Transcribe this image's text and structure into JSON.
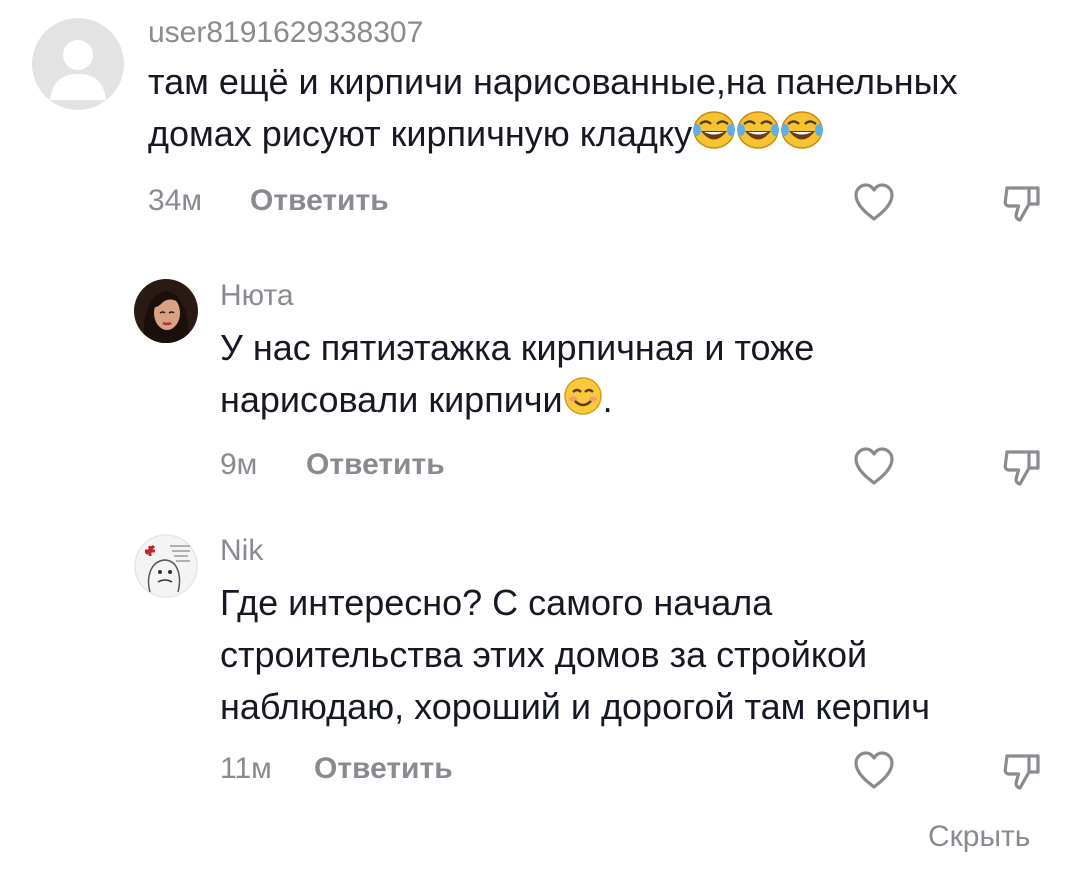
{
  "comments": [
    {
      "username": "user8191629338307",
      "lines": [
        "там ещё и кирпичи нарисованные,на панельных",
        "домах рисуют кирпичную кладку"
      ],
      "emoji": [
        "face-with-tears-of-joy",
        "face-with-tears-of-joy",
        "face-with-tears-of-joy"
      ],
      "time": "34м",
      "reply_label": "Ответить"
    },
    {
      "username": "Нюта",
      "lines": [
        "У нас пятиэтажка кирпичная и тоже",
        "нарисовали кирпичи"
      ],
      "emoji": [
        "smiling-face-with-smiling-eyes"
      ],
      "line2_suffix": ".",
      "time": "9м",
      "reply_label": "Ответить"
    },
    {
      "username": "Nik",
      "lines": [
        "Где интересно? С самого начала",
        "строительства этих домов за стройкой",
        "наблюдаю, хороший и дорогой там керпич"
      ],
      "time": "11м",
      "reply_label": "Ответить"
    }
  ],
  "hide_label": "Скрыть",
  "icons": {
    "like": "heart-outline-icon",
    "dislike": "thumbs-down-outline-icon"
  },
  "colors": {
    "text": "#161823",
    "secondary": "#8a8b91",
    "background": "#ffffff"
  }
}
